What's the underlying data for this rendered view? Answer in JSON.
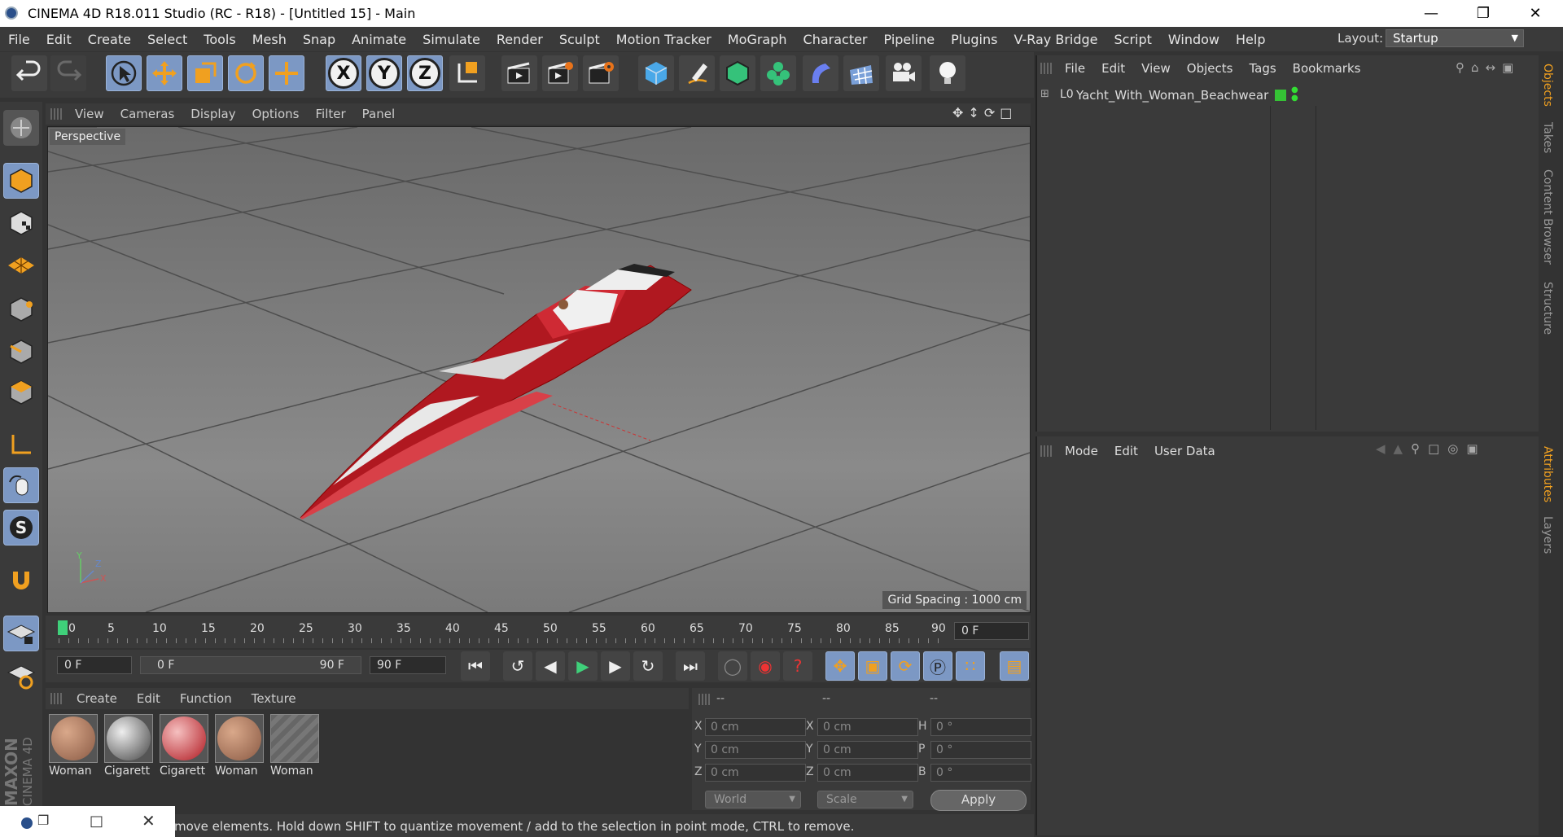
{
  "window": {
    "title": "CINEMA 4D R18.011 Studio (RC - R18) - [Untitled 15] - Main",
    "min_icon": "minimize-icon",
    "restore_icon": "restore-icon",
    "close_icon": "close-icon"
  },
  "menubar": {
    "items": [
      "File",
      "Edit",
      "Create",
      "Select",
      "Tools",
      "Mesh",
      "Snap",
      "Animate",
      "Simulate",
      "Render",
      "Sculpt",
      "Motion Tracker",
      "MoGraph",
      "Character",
      "Pipeline",
      "Plugins",
      "V-Ray Bridge",
      "Script",
      "Window",
      "Help"
    ],
    "layout_label": "Layout:",
    "layout_value": "Startup"
  },
  "viewport": {
    "menu": [
      "View",
      "Cameras",
      "Display",
      "Options",
      "Filter",
      "Panel"
    ],
    "camera_label": "Perspective",
    "grid_spacing": "Grid Spacing : 1000 cm",
    "axis_labels": {
      "x": "X",
      "y": "Y",
      "z": "Z"
    }
  },
  "timeline": {
    "ticks": [
      "0",
      "5",
      "10",
      "15",
      "20",
      "25",
      "30",
      "35",
      "40",
      "45",
      "50",
      "55",
      "60",
      "65",
      "70",
      "75",
      "80",
      "85",
      "90"
    ],
    "current_frame": "0 F"
  },
  "transport": {
    "start_field": "0 F",
    "range_start": "0 F",
    "range_end": "90 F",
    "end_field": "90 F"
  },
  "materials": {
    "menu": [
      "Create",
      "Edit",
      "Function",
      "Texture"
    ],
    "items": [
      {
        "label": "Woman",
        "style": "skin"
      },
      {
        "label": "Cigarett",
        "style": "checker"
      },
      {
        "label": "Cigarett",
        "style": "redcheck"
      },
      {
        "label": "Woman",
        "style": "skin"
      },
      {
        "label": "Woman",
        "style": "hatch"
      }
    ]
  },
  "coordinates": {
    "headers": [
      "--",
      "--",
      "--"
    ],
    "rows": [
      {
        "a": "X",
        "av": "0 cm",
        "b": "X",
        "bv": "0 cm",
        "c": "H",
        "cv": "0 °"
      },
      {
        "a": "Y",
        "av": "0 cm",
        "b": "Y",
        "bv": "0 cm",
        "c": "P",
        "cv": "0 °"
      },
      {
        "a": "Z",
        "av": "0 cm",
        "b": "Z",
        "bv": "0 cm",
        "c": "B",
        "cv": "0 °"
      }
    ],
    "world": "World",
    "scale": "Scale",
    "apply": "Apply"
  },
  "status": {
    "text": "move elements. Hold down SHIFT to quantize movement / add to the selection in point mode, CTRL to remove."
  },
  "object_manager": {
    "menu": [
      "File",
      "Edit",
      "View",
      "Objects",
      "Tags",
      "Bookmarks"
    ],
    "objects": [
      {
        "name": "Yacht_With_Woman_Beachwear",
        "layer_icon": "L0"
      }
    ]
  },
  "attributes": {
    "menu": [
      "Mode",
      "Edit",
      "User Data"
    ]
  },
  "right_tabs": [
    "Objects",
    "Takes",
    "Content Browser",
    "Structure",
    "Attributes",
    "Layers"
  ],
  "branding": {
    "maxon": "MAXON",
    "cinema": "CINEMA 4D"
  },
  "colors": {
    "accent": "#7c98c4",
    "panel": "#3a3a3a",
    "boat_red": "#c8202a",
    "playhead": "#3fd07a"
  }
}
